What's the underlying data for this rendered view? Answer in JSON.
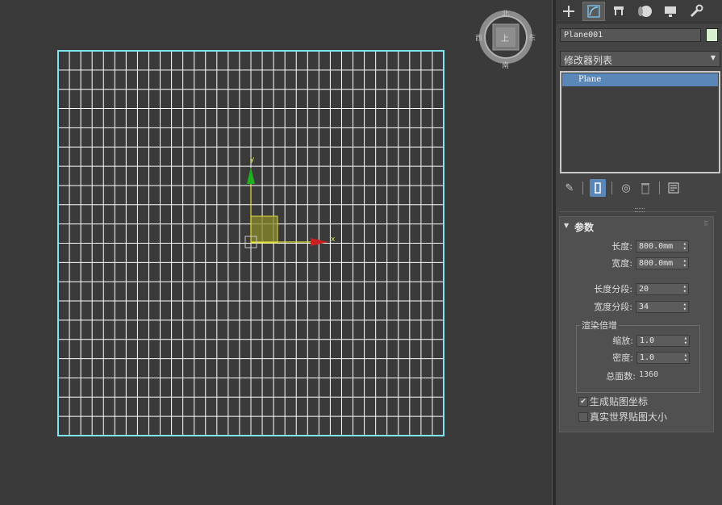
{
  "viewcube": {
    "top": "北",
    "bottom": "南",
    "left": "西",
    "right": "东",
    "face": "上"
  },
  "gizmo": {
    "x_label": "x",
    "y_label": "y"
  },
  "grid": {
    "length_segs": 20,
    "width_segs": 34
  },
  "panel": {
    "tabs": [
      "create-icon",
      "modify-icon",
      "hierarchy-icon",
      "motion-icon",
      "display-icon",
      "utilities-icon"
    ],
    "object_name": "Plane001",
    "object_color": "#d9f0d0",
    "modifier_list": "修改器列表",
    "stack_item": "Plane",
    "rollout": {
      "title": "参数",
      "length_label": "长度:",
      "length_value": "800.0mm",
      "width_label": "宽度:",
      "width_value": "800.0mm",
      "length_segs_label": "长度分段:",
      "length_segs_value": "20",
      "width_segs_label": "宽度分段:",
      "width_segs_value": "34",
      "render_group": "渲染倍增",
      "scale_label": "缩放:",
      "scale_value": "1.0",
      "density_label": "密度:",
      "density_value": "1.0",
      "faces_label": "总面数:",
      "faces_value": "1360",
      "gen_uv_label": "生成贴图坐标",
      "gen_uv_checked": true,
      "real_world_label": "真实世界贴图大小",
      "real_world_checked": false
    }
  },
  "colors": {
    "selection": "#7fe6f0",
    "grid_lines": "#ffffff",
    "stack_highlight": "#5b86b8"
  }
}
